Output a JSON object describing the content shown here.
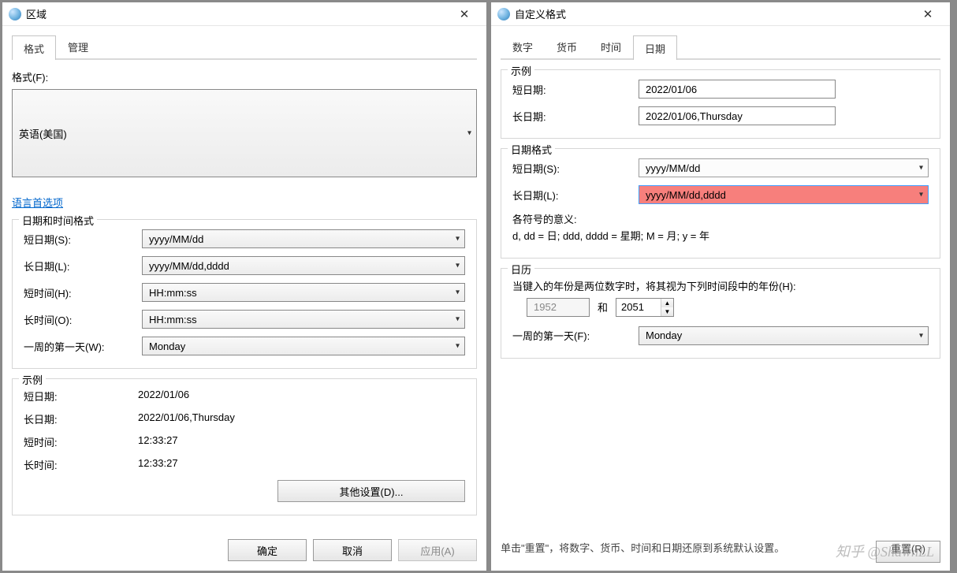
{
  "left": {
    "title": "区域",
    "tabs": [
      "格式",
      "管理"
    ],
    "formatLabel": "格式(F):",
    "formatValue": "英语(美国)",
    "langPref": "语言首选项",
    "dtLegend": "日期和时间格式",
    "shortDateLabel": "短日期(S):",
    "shortDateValue": "yyyy/MM/dd",
    "longDateLabel": "长日期(L):",
    "longDateValue": "yyyy/MM/dd,dddd",
    "shortTimeLabel": "短时间(H):",
    "shortTimeValue": "HH:mm:ss",
    "longTimeLabel": "长时间(O):",
    "longTimeValue": "HH:mm:ss",
    "firstDayLabel": "一周的第一天(W):",
    "firstDayValue": "Monday",
    "sampleLegend": "示例",
    "sample": {
      "shortDateL": "短日期:",
      "shortDateV": "2022/01/06",
      "longDateL": "长日期:",
      "longDateV": "2022/01/06,Thursday",
      "shortTimeL": "短时间:",
      "shortTimeV": "12:33:27",
      "longTimeL": "长时间:",
      "longTimeV": "12:33:27"
    },
    "otherSettings": "其他设置(D)...",
    "ok": "确定",
    "cancel": "取消",
    "apply": "应用(A)"
  },
  "right": {
    "title": "自定义格式",
    "tabs": [
      "数字",
      "货币",
      "时间",
      "日期"
    ],
    "sampleLegend": "示例",
    "sampleShortL": "短日期:",
    "sampleShortV": "2022/01/06",
    "sampleLongL": "长日期:",
    "sampleLongV": "2022/01/06,Thursday",
    "dfLegend": "日期格式",
    "dfShortL": "短日期(S):",
    "dfShortV": "yyyy/MM/dd",
    "dfLongL": "长日期(L):",
    "dfLongV": "yyyy/MM/dd,dddd",
    "meaningTitle": "各符号的意义:",
    "meaning": "d, dd = 日;  ddd, dddd = 星期;  M = 月;  y = 年",
    "calLegend": "日历",
    "calHint": "当键入的年份是两位数字时，将其视为下列时间段中的年份(H):",
    "yearFrom": "1952",
    "and": "和",
    "yearTo": "2051",
    "firstDayL": "一周的第一天(F):",
    "firstDayV": "Monday",
    "resetNote": "单击\"重置\"，将数字、货币、时间和日期还原到系统默认设置。",
    "reset": "重置(R)",
    "watermark": "知乎 @ShawnLL"
  }
}
